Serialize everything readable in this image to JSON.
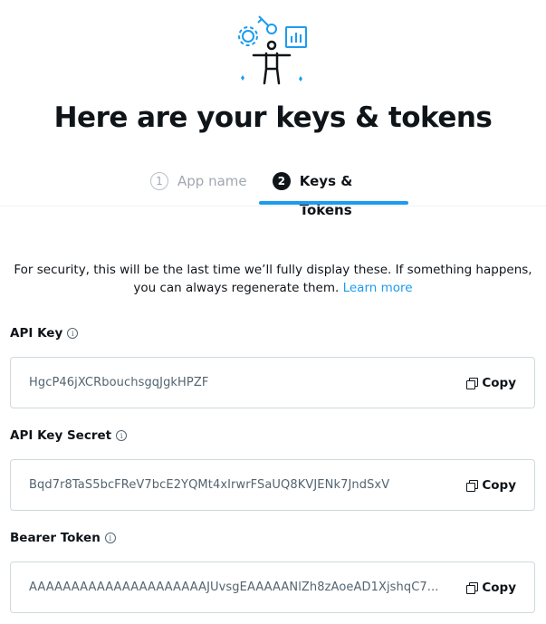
{
  "header": {
    "illustration": "person-with-keys-and-gears-illustration",
    "title": "Here are your keys & tokens"
  },
  "steps": [
    {
      "number": "1",
      "label": "App name",
      "state": "completed"
    },
    {
      "number": "2",
      "label": "Keys & Tokens",
      "state": "active"
    }
  ],
  "notice": {
    "text": "For security, this will be the last time we’ll fully display these. If something happens, you can always regenerate them.",
    "link_text": "Learn more"
  },
  "fields": [
    {
      "label": "API Key",
      "value": "HgcP46jXCRbouchsgqJgkHPZF",
      "copy_label": "Copy"
    },
    {
      "label": "API Key Secret",
      "value": "Bqd7r8TaS5bcFReV7bcE2YQMt4xIrwrFSaUQ8KVJENk7JndSxV",
      "copy_label": "Copy"
    },
    {
      "label": "Bearer Token",
      "value": "AAAAAAAAAAAAAAAAAAAAAJUvsgEAAAAANlZh8zAoeAD1XjshqC7...",
      "copy_label": "Copy"
    }
  ],
  "colors": {
    "accent": "#1d9bf0",
    "text": "#0f1419",
    "muted": "#536471",
    "border": "#cfd9de"
  },
  "icons": {
    "info": "info-icon",
    "copy": "copy-icon"
  }
}
